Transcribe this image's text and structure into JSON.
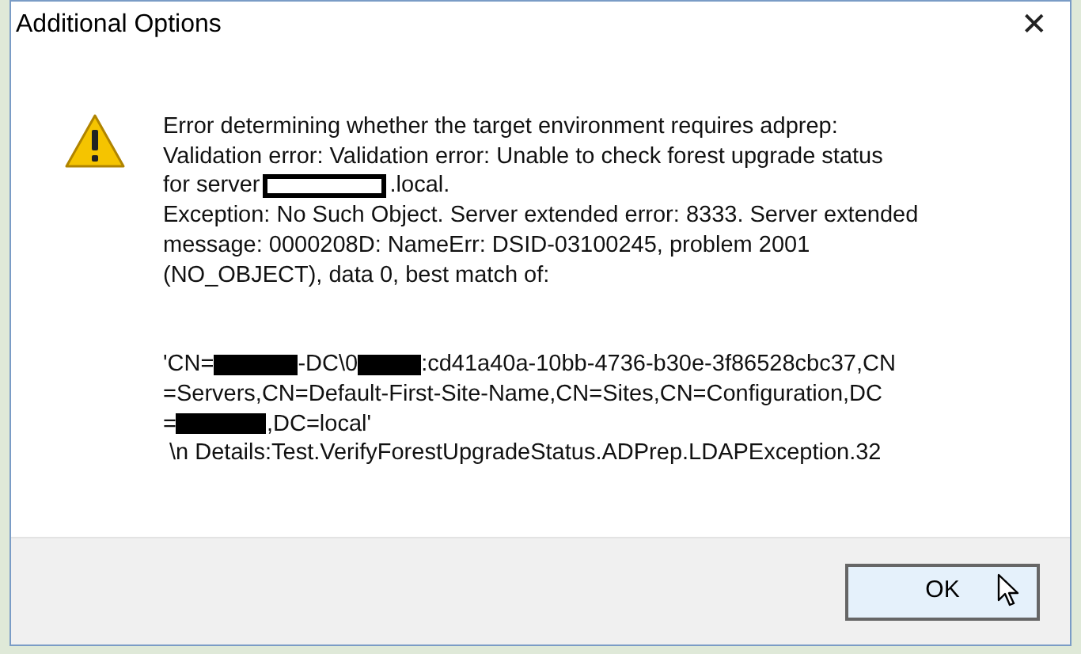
{
  "window": {
    "title": "Additional Options",
    "close": "✕"
  },
  "message": {
    "paragraphs": [
      {
        "lines": [
          {
            "parts": [
              {
                "kind": "text",
                "text": "Error determining whether the target environment requires adprep:"
              }
            ]
          },
          {
            "parts": [
              {
                "kind": "text",
                "text": "Validation error: Validation error: Unable to check forest upgrade status"
              }
            ]
          },
          {
            "parts": [
              {
                "kind": "text",
                "text": "for server"
              },
              {
                "kind": "outline_redaction"
              },
              {
                "kind": "text",
                "text": ".local."
              }
            ]
          },
          {
            "parts": [
              {
                "kind": "text",
                "text": "Exception: No Such Object. Server extended error: 8333. Server extended"
              }
            ]
          },
          {
            "parts": [
              {
                "kind": "text",
                "text": "message: 0000208D: NameErr: DSID-03100245, problem 2001"
              }
            ]
          },
          {
            "parts": [
              {
                "kind": "text",
                "text": "(NO_OBJECT), data 0, best match of:"
              }
            ]
          }
        ]
      },
      {
        "lines": [
          {
            "parts": [
              {
                "kind": "text",
                "text": "'CN="
              },
              {
                "kind": "solid_redaction"
              },
              {
                "kind": "text",
                "text": "-DC\\0"
              },
              {
                "kind": "solid_redaction"
              },
              {
                "kind": "text",
                "text": ":cd41a40a-10bb-4736-b30e-3f86528cbc37,CN"
              }
            ]
          },
          {
            "parts": [
              {
                "kind": "text",
                "text": "=Servers,CN=Default-First-Site-Name,CN=Sites,CN=Configuration,DC"
              }
            ]
          },
          {
            "parts": [
              {
                "kind": "text",
                "text": "="
              },
              {
                "kind": "solid_redaction"
              },
              {
                "kind": "text",
                "text": ",DC=local'"
              }
            ]
          },
          {
            "parts": [
              {
                "kind": "text",
                "text": " \\n Details:Test.VerifyForestUpgradeStatus.ADPrep.LDAPException.32"
              }
            ]
          }
        ]
      }
    ]
  },
  "buttons": [
    {
      "label": "OK",
      "hovered": true
    }
  ]
}
